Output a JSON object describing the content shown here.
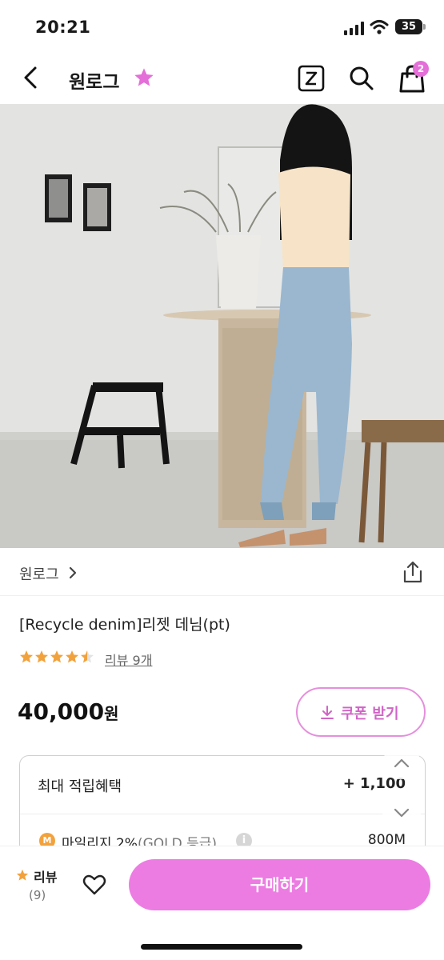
{
  "status_bar": {
    "time": "20:21",
    "battery": "35"
  },
  "nav": {
    "title": "원로그",
    "cart_count": "2",
    "z_label": "Z"
  },
  "store": {
    "name": "원로그"
  },
  "product": {
    "name": "[Recycle denim]리젯 데님(pt)",
    "rating": 4.5,
    "review_link": "리뷰 9개",
    "price": "40,000",
    "price_unit": "원"
  },
  "coupon": {
    "label": "쿠폰 받기"
  },
  "reward": {
    "title": "최대 적립혜택",
    "total": "+ 1,100",
    "mileage_badge": "M",
    "mileage_label": "마일리지 2%",
    "mileage_grade": "(GOLD 등급)",
    "mileage_value": "800M"
  },
  "bottom": {
    "review_label": "리뷰",
    "review_count": "(9)",
    "buy_label": "구매하기"
  },
  "colors": {
    "accent": "#ec7ce2",
    "star": "#f2a23c",
    "favorite_star": "#e46fd8"
  },
  "icons": [
    "back-chevron-icon",
    "favorite-star-icon",
    "z-icon",
    "search-icon",
    "shopping-bag-icon",
    "share-icon",
    "download-icon",
    "info-icon",
    "heart-icon",
    "chevron-up-icon",
    "chevron-down-icon"
  ]
}
